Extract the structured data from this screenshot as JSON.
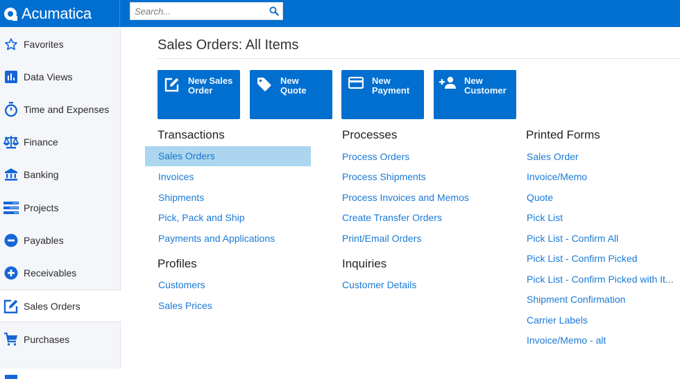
{
  "app": {
    "brand": "Acumatica",
    "accent_color": "#006fcf"
  },
  "search": {
    "placeholder": "Search..."
  },
  "sidebar": {
    "items": [
      {
        "label": "Favorites",
        "icon": "star-icon"
      },
      {
        "label": "Data Views",
        "icon": "bar-chart-icon"
      },
      {
        "label": "Time and Expenses",
        "icon": "stopwatch-icon"
      },
      {
        "label": "Finance",
        "icon": "scales-icon"
      },
      {
        "label": "Banking",
        "icon": "bank-icon"
      },
      {
        "label": "Projects",
        "icon": "projects-icon"
      },
      {
        "label": "Payables",
        "icon": "minus-circle-icon"
      },
      {
        "label": "Receivables",
        "icon": "plus-circle-icon"
      },
      {
        "label": "Sales Orders",
        "icon": "edit-icon",
        "active": true
      },
      {
        "label": "Purchases",
        "icon": "cart-icon"
      }
    ]
  },
  "main": {
    "title": "Sales Orders: All Items",
    "tiles": [
      {
        "label_line1": "New Sales",
        "label_line2": "Order",
        "icon": "edit-icon"
      },
      {
        "label_line1": "New Quote",
        "label_line2": "",
        "icon": "tag-icon"
      },
      {
        "label_line1": "New",
        "label_line2": "Payment",
        "icon": "credit-card-icon"
      },
      {
        "label_line1": "New",
        "label_line2": "Customer",
        "icon": "add-person-icon"
      }
    ],
    "sections": {
      "transactions": {
        "title": "Transactions",
        "links": [
          "Sales Orders",
          "Invoices",
          "Shipments",
          "Pick, Pack and Ship",
          "Payments and Applications"
        ],
        "selected": "Sales Orders"
      },
      "profiles": {
        "title": "Profiles",
        "links": [
          "Customers",
          "Sales Prices"
        ]
      },
      "processes": {
        "title": "Processes",
        "links": [
          "Process Orders",
          "Process Shipments",
          "Process Invoices and Memos",
          "Create Transfer Orders",
          "Print/Email Orders"
        ]
      },
      "inquiries": {
        "title": "Inquiries",
        "links": [
          "Customer Details"
        ]
      },
      "printed_forms": {
        "title": "Printed Forms",
        "links": [
          "Sales Order",
          "Invoice/Memo",
          "Quote",
          "Pick List",
          "Pick List - Confirm All",
          "Pick List - Confirm Picked",
          "Pick List - Confirm Picked with It...",
          "Shipment Confirmation",
          "Carrier Labels",
          "Invoice/Memo - alt"
        ]
      }
    }
  }
}
